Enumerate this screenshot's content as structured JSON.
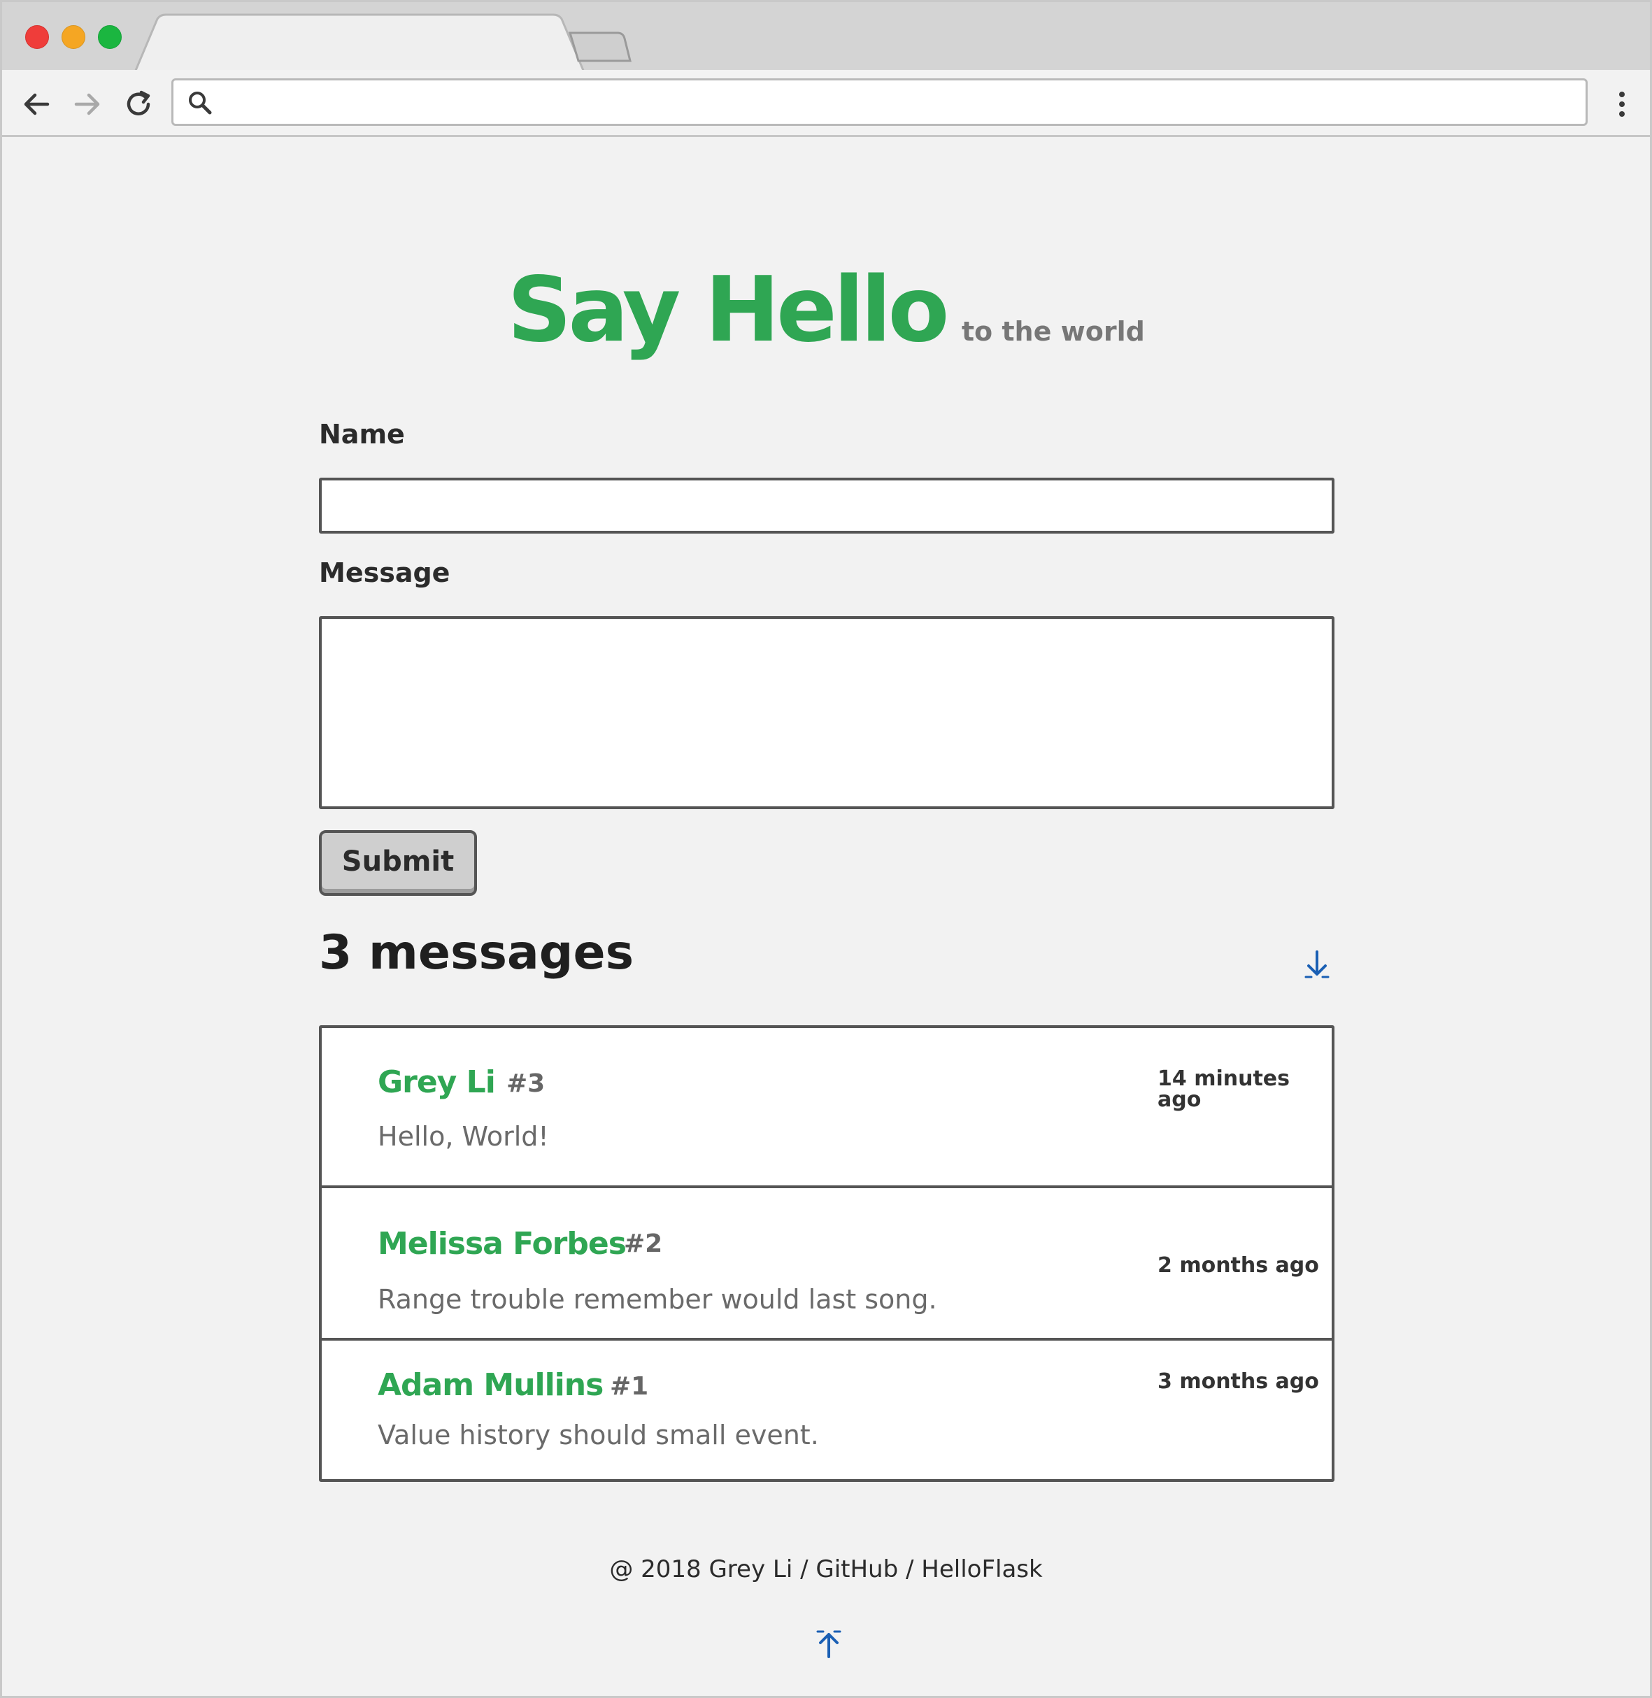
{
  "browser": {
    "address": {
      "value": "",
      "placeholder": ""
    },
    "icons": {
      "back": "back-arrow-icon",
      "forward": "forward-arrow-icon",
      "reload": "reload-icon",
      "search": "search-icon",
      "menu": "more-vert-icon"
    }
  },
  "header": {
    "title": "Say Hello",
    "subtitle": "to the world"
  },
  "form": {
    "name_label": "Name",
    "name_value": "",
    "message_label": "Message",
    "message_value": "",
    "submit_label": "Submit"
  },
  "messages": {
    "count_label": "3 messages",
    "scroll_down_icon": "arrow-down-icon",
    "items": [
      {
        "name": "Grey Li",
        "id": "#3",
        "time": "14 minutes ago",
        "body": "Hello, World!"
      },
      {
        "name": "Melissa Forbes",
        "id": "#2",
        "time": "2 months ago",
        "body": "Range trouble remember would last song."
      },
      {
        "name": "Adam Mullins",
        "id": "#1",
        "time": "3 months ago",
        "body": "Value history should small event."
      }
    ]
  },
  "footer": {
    "copyright": "@ 2018 Grey Li",
    "sep1": " / ",
    "github": "GitHub",
    "sep2": " / ",
    "helloflask": "HelloFlask",
    "scroll_up_icon": "arrow-up-icon"
  },
  "colors": {
    "brand_green": "#2fa653",
    "link_blue": "#1a5fb4",
    "traffic_red": "#ef3d3a",
    "traffic_yellow": "#f5a623",
    "traffic_green": "#1bb640"
  }
}
